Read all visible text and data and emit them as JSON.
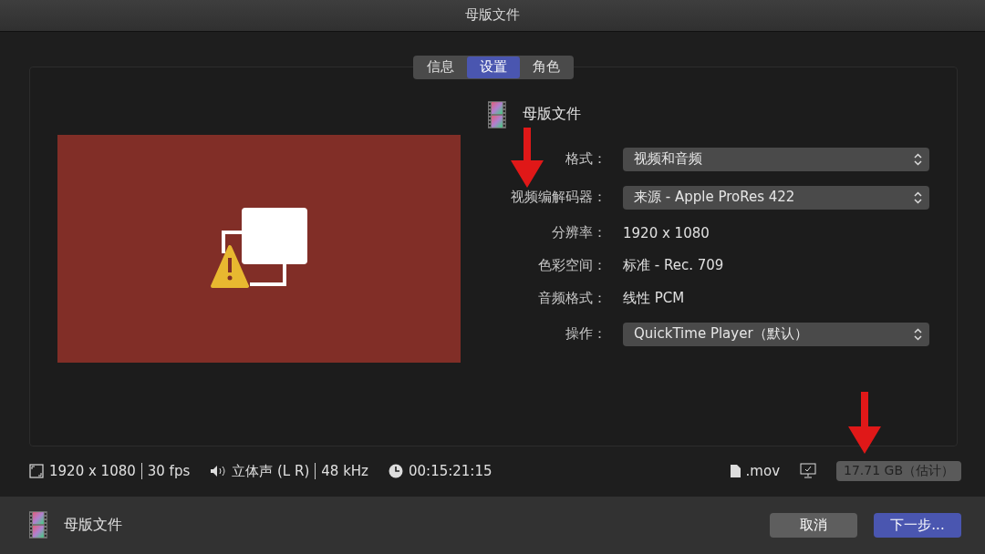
{
  "window": {
    "title": "母版文件"
  },
  "tabs": [
    {
      "label": "信息",
      "selected": false
    },
    {
      "label": "设置",
      "selected": true
    },
    {
      "label": "角色",
      "selected": false
    }
  ],
  "settings": {
    "name": "母版文件",
    "rows": [
      {
        "kind": "select",
        "label": "格式：",
        "value": "视频和音频"
      },
      {
        "kind": "select",
        "label": "视频编解码器：",
        "value": "来源 - Apple ProRes 422"
      },
      {
        "kind": "text",
        "label": "分辨率：",
        "value": "1920 x 1080"
      },
      {
        "kind": "text",
        "label": "色彩空间：",
        "value": "标准 - Rec. 709"
      },
      {
        "kind": "text",
        "label": "音频格式：",
        "value": "线性 PCM"
      },
      {
        "kind": "select",
        "label": "操作：",
        "value": "QuickTime Player（默认）"
      }
    ]
  },
  "status_bar": {
    "resolution": "1920 x 1080",
    "fps": "30 fps",
    "audio": "立体声 (L R)",
    "sample_rate": "48 kHz",
    "duration": "00:15:21:15",
    "extension": ".mov",
    "size": "17.71 GB（估计）"
  },
  "footer": {
    "name": "母版文件",
    "buttons": [
      {
        "label": "取消",
        "kind": "secondary"
      },
      {
        "label": "下一步...",
        "kind": "primary"
      }
    ]
  }
}
